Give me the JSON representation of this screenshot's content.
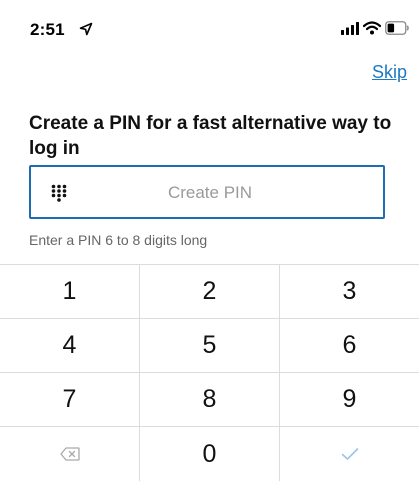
{
  "status_bar": {
    "time": "2:51",
    "icons": [
      "location-arrow-icon",
      "cellular-signal-icon",
      "wifi-icon",
      "battery-icon"
    ]
  },
  "header": {
    "skip_label": "Skip"
  },
  "prompt": {
    "title": "Create a PIN for a fast alternative way to log in"
  },
  "pin_field": {
    "placeholder": "Create PIN",
    "value": "",
    "icon": "keypad-icon"
  },
  "hint": "Enter a PIN 6 to 8 digits long",
  "keypad": {
    "rows": [
      [
        "1",
        "2",
        "3"
      ],
      [
        "4",
        "5",
        "6"
      ],
      [
        "7",
        "8",
        "9"
      ]
    ],
    "bottom_row": {
      "left_icon": "backspace-icon",
      "center": "0",
      "right_icon": "checkmark-icon"
    }
  },
  "colors": {
    "accent": "#1E78C2",
    "field_border": "#1E6CB1",
    "divider": "#dcdcdc",
    "disabled_icon": "#a9a9a9",
    "check_icon": "#9ec3e6"
  }
}
